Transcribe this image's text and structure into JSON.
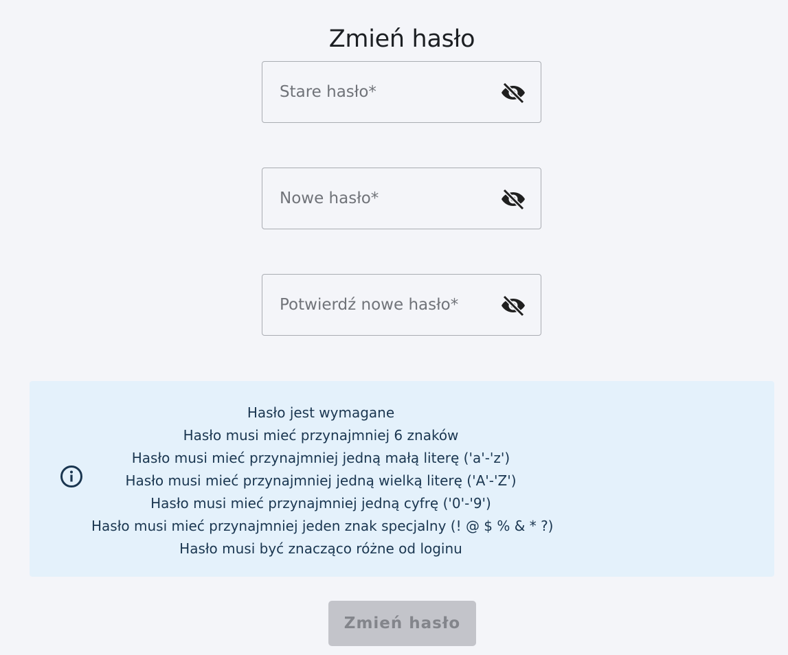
{
  "page": {
    "title": "Zmień hasło"
  },
  "form": {
    "fields": [
      {
        "placeholder": "Stare hasło*",
        "value": "",
        "visibility_icon": "eye-off-icon"
      },
      {
        "placeholder": "Nowe hasło*",
        "value": "",
        "visibility_icon": "eye-off-icon"
      },
      {
        "placeholder": "Potwierdź nowe hasło*",
        "value": "",
        "visibility_icon": "eye-off-icon"
      }
    ],
    "submit_label": "Zmień hasło",
    "submit_disabled": true
  },
  "requirements": {
    "icon": "info-icon",
    "items": [
      "Hasło jest wymagane",
      "Hasło musi mieć przynajmniej 6 znaków",
      "Hasło musi mieć przynajmniej jedną małą literę ('a'-'z')",
      "Hasło musi mieć przynajmniej jedną wielką literę ('A'-'Z')",
      "Hasło musi mieć przynajmniej jedną cyfrę ('0'-'9')",
      "Hasło musi mieć przynajmniej jeden znak specjalny (! @ $ % & * ?)",
      "Hasło musi być znacząco różne od loginu"
    ]
  },
  "colors": {
    "background": "#f4f5f9",
    "info_background": "#e4f1fb",
    "info_text": "#1a3650",
    "button_disabled_bg": "#c3c4ca",
    "button_disabled_text": "#83858b"
  }
}
